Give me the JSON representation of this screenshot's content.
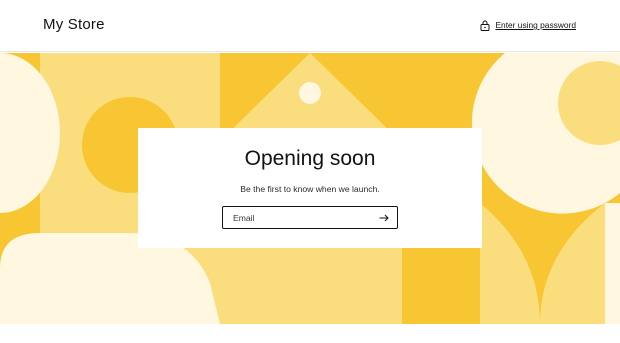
{
  "header": {
    "store_name": "My Store",
    "password_link_label": "Enter using password",
    "password_icon": "lock-icon"
  },
  "card": {
    "title": "Opening soon",
    "subtitle": "Be the first to know when we launch.",
    "email_placeholder": "Email",
    "submit_icon": "arrow-right-icon"
  },
  "colors": {
    "banner_dark": "#f8c633",
    "banner_light": "#fadd7d",
    "banner_cream": "#fff7e0",
    "text": "#121212"
  }
}
